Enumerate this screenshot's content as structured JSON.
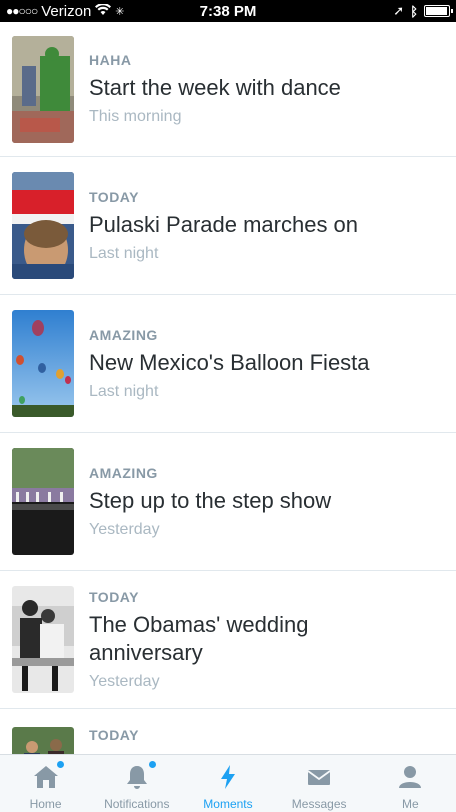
{
  "status": {
    "carrier": "Verizon",
    "time": "7:38 PM"
  },
  "moments": [
    {
      "category": "HAHA",
      "title": "Start the week with dance",
      "time": "This morning"
    },
    {
      "category": "TODAY",
      "title": "Pulaski Parade marches on",
      "time": "Last night"
    },
    {
      "category": "AMAZING",
      "title": "New Mexico's Balloon Fiesta",
      "time": "Last night"
    },
    {
      "category": "AMAZING",
      "title": "Step up to the step show",
      "time": "Yesterday"
    },
    {
      "category": "TODAY",
      "title": "The Obamas' wedding anniversary",
      "time": "Yesterday"
    },
    {
      "category": "TODAY"
    }
  ],
  "tabs": [
    {
      "label": "Home",
      "icon": "home-icon"
    },
    {
      "label": "Notifications",
      "icon": "bell-icon"
    },
    {
      "label": "Moments",
      "icon": "lightning-icon"
    },
    {
      "label": "Messages",
      "icon": "envelope-icon"
    },
    {
      "label": "Me",
      "icon": "person-icon"
    }
  ],
  "colors": {
    "accent": "#1da1f2",
    "muted": "#8899a6"
  }
}
